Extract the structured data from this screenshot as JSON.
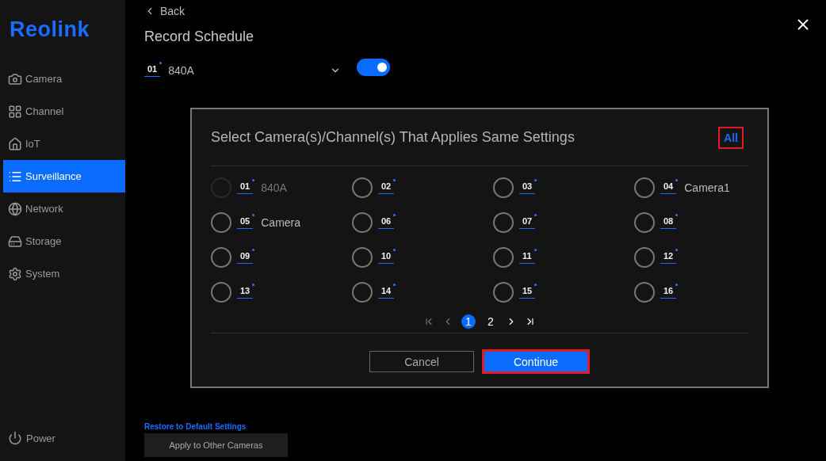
{
  "sidebar": {
    "logo": "Reolink",
    "items": [
      {
        "label": "Camera",
        "selected": false
      },
      {
        "label": "Channel",
        "selected": false
      },
      {
        "label": "IoT",
        "selected": false
      },
      {
        "label": "Surveillance",
        "selected": true
      },
      {
        "label": "Network",
        "selected": false
      },
      {
        "label": "Storage",
        "selected": false
      },
      {
        "label": "System",
        "selected": false
      }
    ],
    "power": "Power"
  },
  "header": {
    "back": "Back",
    "title": "Record Schedule"
  },
  "camera_select": {
    "number": "01",
    "name": "840A",
    "enabled": true
  },
  "dialog": {
    "title": "Select Camera(s)/Channel(s) That Applies Same Settings",
    "all": {
      "label": "All",
      "highlighted": true
    },
    "channels": [
      {
        "number": "01",
        "name": "840A",
        "disabled": true,
        "checked": false
      },
      {
        "number": "02",
        "disabled": false,
        "checked": false
      },
      {
        "number": "03",
        "disabled": false,
        "checked": false
      },
      {
        "number": "04",
        "name": "Camera1",
        "disabled": false,
        "checked": false
      },
      {
        "number": "05",
        "name": "Camera",
        "disabled": false,
        "checked": false
      },
      {
        "number": "06",
        "disabled": false,
        "checked": false
      },
      {
        "number": "07",
        "disabled": false,
        "checked": false
      },
      {
        "number": "08",
        "disabled": false,
        "checked": false
      },
      {
        "number": "09",
        "disabled": false,
        "checked": false
      },
      {
        "number": "10",
        "disabled": false,
        "checked": false
      },
      {
        "number": "11",
        "disabled": false,
        "checked": false
      },
      {
        "number": "12",
        "disabled": false,
        "checked": false
      },
      {
        "number": "13",
        "disabled": false,
        "checked": false
      },
      {
        "number": "14",
        "disabled": false,
        "checked": false
      },
      {
        "number": "15",
        "disabled": false,
        "checked": false
      },
      {
        "number": "16",
        "disabled": false,
        "checked": false
      }
    ],
    "pages": [
      {
        "label": "1",
        "selected": true
      },
      {
        "label": "2",
        "selected": false
      }
    ],
    "cancel": {
      "label": "Cancel",
      "highlighted": false
    },
    "continue": {
      "label": "Continue",
      "highlighted": true
    }
  },
  "footer": {
    "restore": "Restore to Default Settings",
    "apply": "Apply to Other Cameras"
  }
}
